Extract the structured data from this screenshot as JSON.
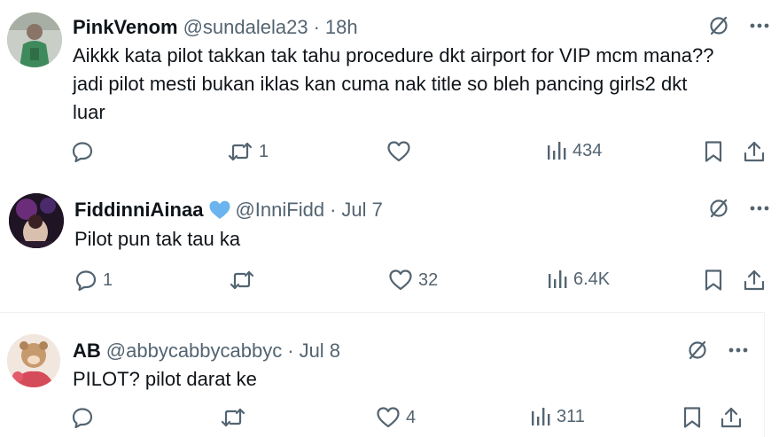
{
  "tweets": [
    {
      "name": "PinkVenom",
      "handle": "@sundalela23",
      "time": "18h",
      "verified": false,
      "text_lines": [
        "Aikkk kata pilot takkan tak tahu procedure dkt airport for VIP mcm mana??",
        "jadi pilot mesti bukan iklas kan cuma nak title so bleh pancing girls2 dkt",
        "luar"
      ],
      "replies": "",
      "reposts": "1",
      "likes": "",
      "views": "434"
    },
    {
      "name": "FiddinniAinaa",
      "handle": "@InniFidd",
      "time": "Jul 7",
      "verified": true,
      "text_lines": [
        "Pilot pun tak tau ka"
      ],
      "replies": "1",
      "reposts": "",
      "likes": "32",
      "views": "6.4K"
    },
    {
      "name": "AB",
      "handle": "@abbycabbycabbyc",
      "time": "Jul 8",
      "verified": false,
      "text_lines": [
        "PILOT? pilot darat ke"
      ],
      "replies": "",
      "reposts": "",
      "likes": "4",
      "views": "311"
    }
  ],
  "separator": "·",
  "icons": {
    "grok": "grok-slash-icon",
    "more": "more-dots-icon",
    "reply": "reply-bubble-icon",
    "repost": "repost-arrows-icon",
    "like": "heart-icon",
    "views": "views-bars-icon",
    "bookmark": "bookmark-icon",
    "share": "share-upload-icon"
  },
  "colors": {
    "text": "#0f1419",
    "secondary": "#536471",
    "verified": "#6cb4ee",
    "divider": "#eff3f4"
  }
}
